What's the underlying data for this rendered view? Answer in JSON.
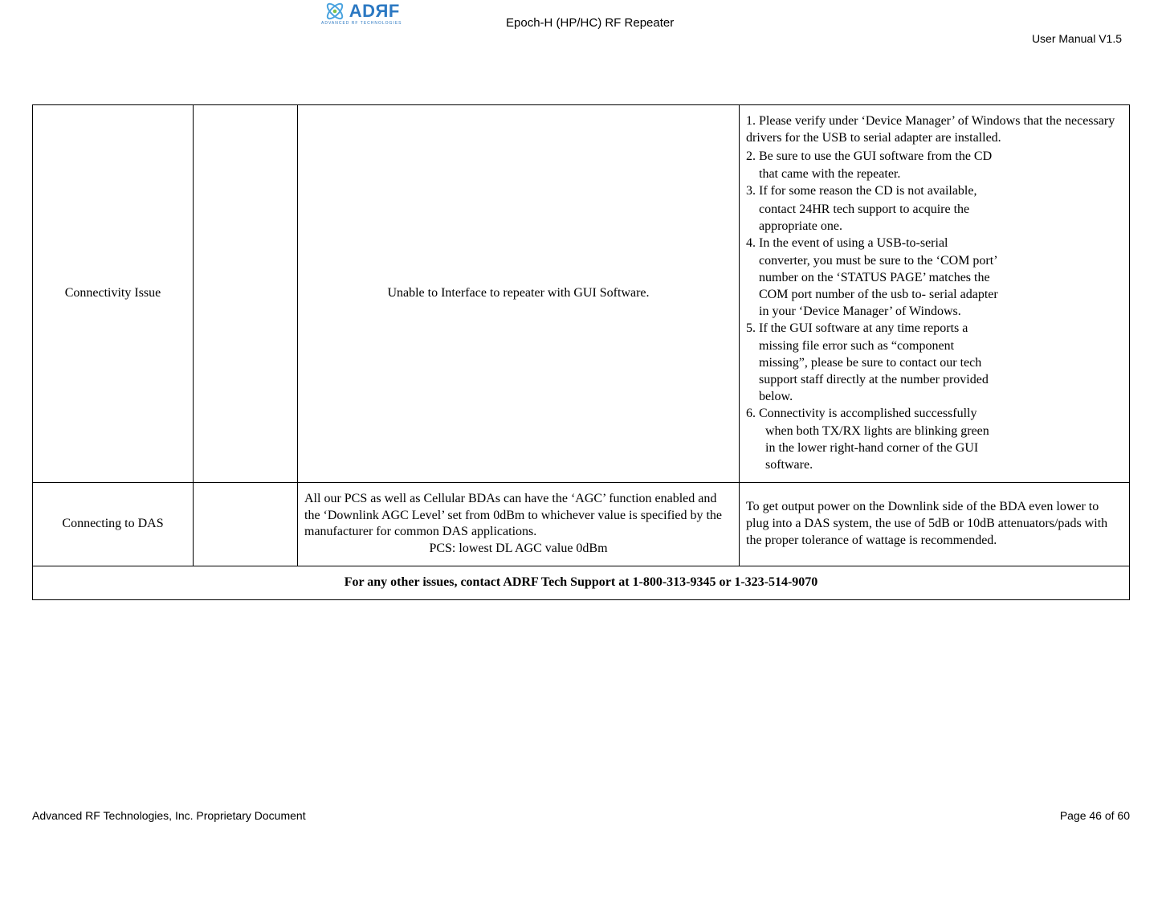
{
  "header": {
    "logo_text": "ADRF",
    "logo_sub": "ADVANCED RF TECHNOLOGIES",
    "title_center": "Epoch-H (HP/HC) RF Repeater",
    "title_right": "User Manual V1.5"
  },
  "table": {
    "row1": {
      "topic": "Connectivity Issue",
      "desc": "Unable to Interface to repeater with GUI Software.",
      "steps": {
        "s1": "1. Please verify under ‘Device Manager’ of Windows that the necessary drivers for the USB to serial adapter are installed.",
        "s2a": "2. Be sure to use the GUI software from the CD",
        "s2b": "that came with the repeater.",
        "s3a": "3. If for some reason the CD is not available,",
        "s3b": "contact 24HR tech support to acquire the",
        "s3c": "appropriate one.",
        "s4a": "4. In the event of using a USB-to-serial",
        "s4b": "converter, you must be sure to the ‘COM port’",
        "s4c": "number on the ‘STATUS PAGE’ matches the",
        "s4d": "COM port number of the usb to- serial adapter",
        "s4e": "in your ‘Device Manager’ of Windows.",
        "s5a": "5. If the GUI software at any time reports a",
        "s5b": "missing file error such as “component",
        "s5c": "missing”, please be sure to contact our tech",
        "s5d": "support staff directly at the number provided",
        "s5e": "below.",
        "s6a": "6. Connectivity is accomplished successfully",
        "s6b": "when both TX/RX lights are blinking green",
        "s6c": "in the lower right-hand corner of the GUI",
        "s6d": "software."
      }
    },
    "row2": {
      "topic": "Connecting to DAS",
      "desc_main": "All our PCS as well as Cellular BDAs can have the ‘AGC’ function enabled and the ‘Downlink AGC Level’ set from 0dBm to whichever value is specified by the manufacturer for common DAS applications.",
      "desc_sub": "PCS: lowest DL AGC value 0dBm",
      "action": "To get output power on the Downlink side of the BDA even lower to plug into a DAS system, the use of 5dB or 10dB attenuators/pads with the proper tolerance of wattage is recommended."
    },
    "contact": "For any other issues, contact ADRF Tech Support at 1-800-313-9345 or 1-323-514-9070"
  },
  "footer": {
    "left": "Advanced RF Technologies, Inc. Proprietary Document",
    "right": "Page 46 of 60"
  }
}
